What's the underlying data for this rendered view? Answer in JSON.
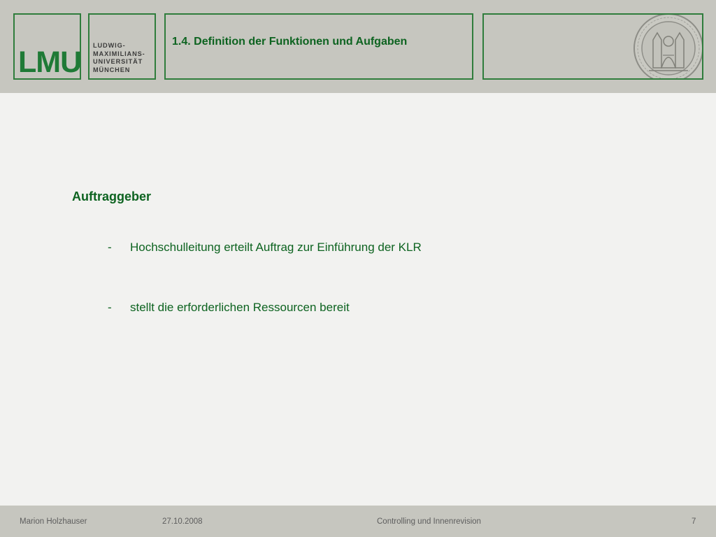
{
  "header": {
    "logo_text": "LMU",
    "university_lines": [
      "LUDWIG-",
      "MAXIMILIANS-",
      "UNIVERSITÄT",
      "MÜNCHEN"
    ],
    "slide_title": "1.4. Definition der Funktionen und Aufgaben",
    "seal_icon": "university-seal-icon"
  },
  "content": {
    "heading": "Auftraggeber",
    "bullets": [
      {
        "marker": "-",
        "text": "Hochschulleitung erteilt Auftrag zur Einführung der KLR"
      },
      {
        "marker": "-",
        "text": "stellt die erforderlichen Ressourcen bereit"
      }
    ]
  },
  "footer": {
    "author": "Marion Holzhauser",
    "date": "27.10.2008",
    "course": "Controlling und Innenrevision",
    "page_number": "7"
  },
  "colors": {
    "accent_green": "#0d6320",
    "logo_green": "#1f7a36",
    "header_bg": "#c6c6bf",
    "slide_bg": "#f2f2f0"
  }
}
